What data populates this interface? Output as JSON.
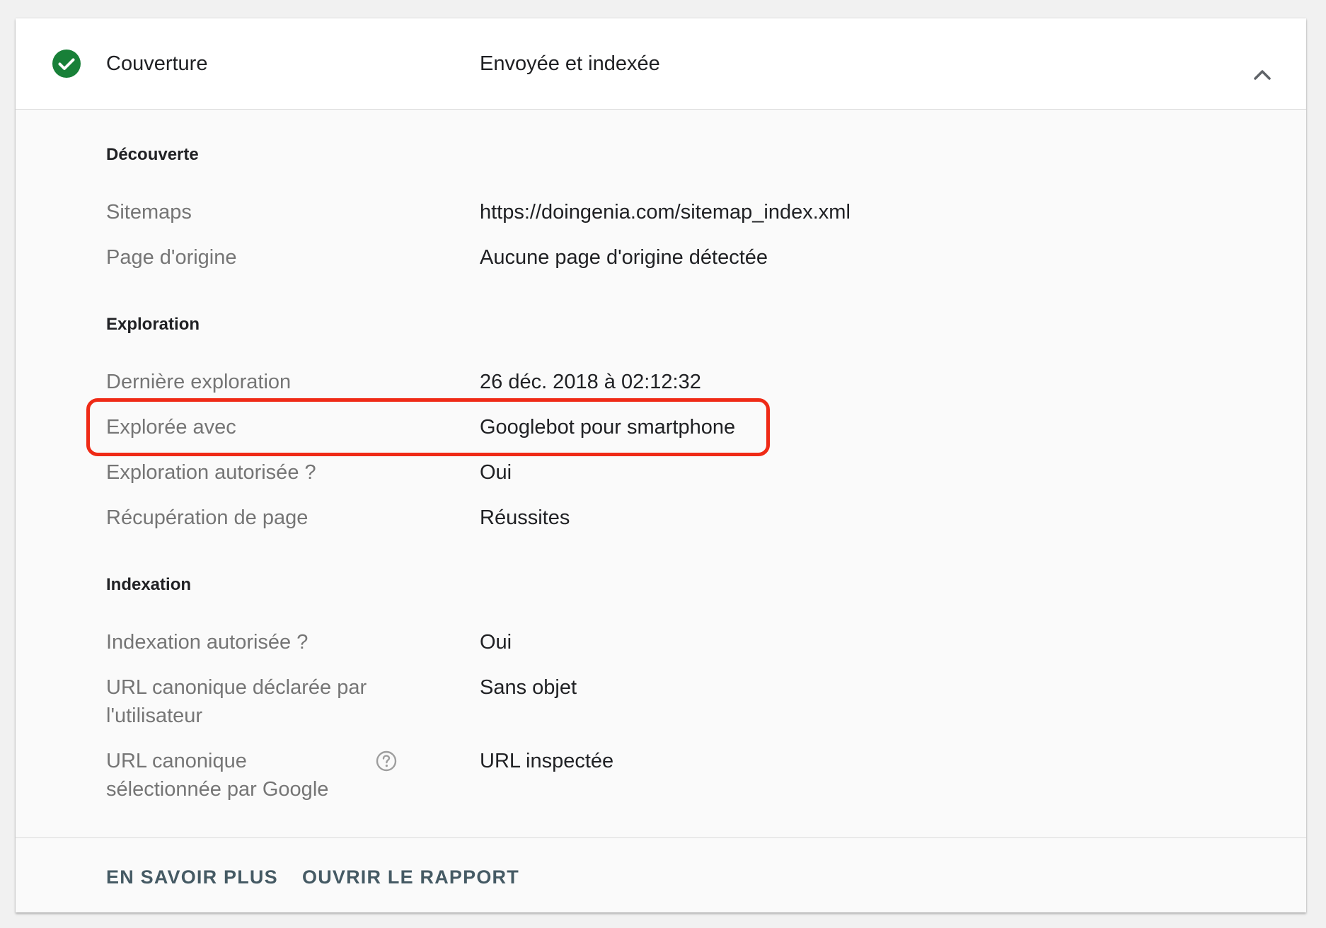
{
  "header": {
    "label": "Couverture",
    "value": "Envoyée et indexée",
    "status_icon": "check-circle-icon",
    "status_color": "#188038",
    "toggle_icon": "chevron-up-icon"
  },
  "sections": {
    "discovery": {
      "title": "Découverte",
      "rows": [
        {
          "label": "Sitemaps",
          "value": "https://doingenia.com/sitemap_index.xml"
        },
        {
          "label": "Page d'origine",
          "value": "Aucune page d'origine détectée"
        }
      ]
    },
    "crawl": {
      "title": "Exploration",
      "rows": [
        {
          "label": "Dernière exploration",
          "value": "26 déc. 2018 à 02:12:32"
        },
        {
          "label": "Explorée avec",
          "value": "Googlebot pour smartphone"
        },
        {
          "label": "Exploration autorisée ?",
          "value": "Oui"
        },
        {
          "label": "Récupération de page",
          "value": "Réussites"
        }
      ]
    },
    "indexing": {
      "title": "Indexation",
      "rows": [
        {
          "label": "Indexation autorisée ?",
          "value": "Oui"
        },
        {
          "label_line1": "URL canonique déclarée par",
          "label_line2": "l'utilisateur",
          "value": "Sans objet"
        },
        {
          "label_line1": "URL canonique",
          "label_line2": "sélectionnée par Google",
          "value": "URL inspectée",
          "help_icon": "help-circle-icon"
        }
      ]
    }
  },
  "highlight_color": "#ef2a16",
  "footer": {
    "learn_more": "EN SAVOIR PLUS",
    "open_report": "OUVRIR LE RAPPORT"
  }
}
